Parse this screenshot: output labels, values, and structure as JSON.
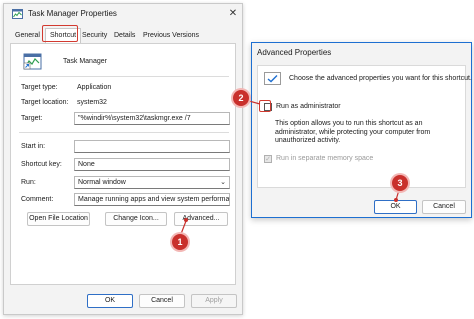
{
  "properties_window": {
    "title": "Task Manager Properties",
    "close_glyph": "✕",
    "tabs": [
      "General",
      "Shortcut",
      "Security",
      "Details",
      "Previous Versions"
    ],
    "active_tab": "Shortcut",
    "app_name": "Task Manager",
    "target_type_label": "Target type:",
    "target_type_value": "Application",
    "target_location_label": "Target location:",
    "target_location_value": "system32",
    "target_label": "Target:",
    "target_value": "\"%windir%\\system32\\taskmgr.exe /7",
    "start_in_label": "Start in:",
    "start_in_value": "",
    "shortcut_key_label": "Shortcut key:",
    "shortcut_key_value": "None",
    "run_label": "Run:",
    "run_value": "Normal window",
    "comment_label": "Comment:",
    "comment_value": "Manage running apps and view system performance",
    "open_file_location_button": "Open File Location",
    "change_icon_button": "Change Icon...",
    "advanced_button": "Advanced...",
    "ok_button": "OK",
    "cancel_button": "Cancel",
    "apply_button": "Apply"
  },
  "advanced_dialog": {
    "title": "Advanced Properties",
    "intro_text": "Choose the advanced properties you want for this shortcut.",
    "run_as_admin_label": "Run as administrator",
    "run_as_admin_checked": false,
    "admin_description": "This option allows you to run this shortcut as an administrator, while protecting your computer from unauthorized activity.",
    "separate_memory_label": "Run in separate memory space",
    "separate_memory_checked": true,
    "separate_memory_enabled": false,
    "ok_button": "OK",
    "cancel_button": "Cancel"
  },
  "annotations": {
    "step1": "1",
    "step2": "2",
    "step3": "3",
    "color": "#c9302c"
  },
  "icons": {
    "app_icon": "task-manager-icon",
    "shortcut_arrow": "shortcut-arrow-icon",
    "close": "close-icon",
    "checkmark": "checkmark-icon"
  }
}
